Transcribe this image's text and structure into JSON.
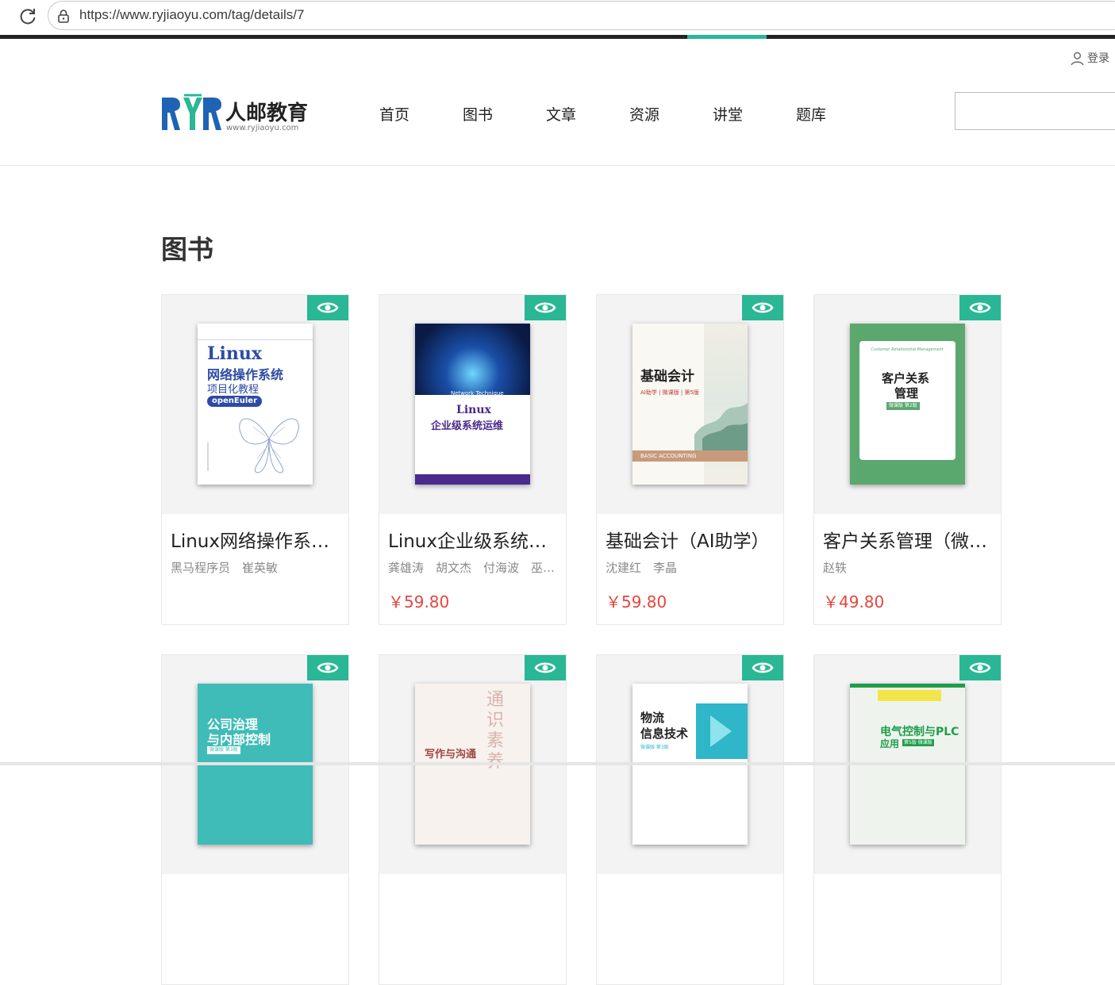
{
  "browser": {
    "url": "https://www.ryjiaoyu.com/tag/details/7"
  },
  "header": {
    "login_label": "登录",
    "logo_text": "人邮教育",
    "logo_url": "www.ryjiaoyu.com",
    "nav": [
      "首页",
      "图书",
      "文章",
      "资源",
      "讲堂",
      "题库"
    ],
    "search_value": ""
  },
  "section": {
    "title": "图书"
  },
  "books": [
    {
      "title": "Linux网络操作系统项目化教程",
      "authors": "黑马程序员　崔英敏",
      "price": "",
      "cover": {
        "line1": "Linux",
        "line2": "网络操作系统",
        "line3": "项目化教程",
        "tag": "openEuler"
      }
    },
    {
      "title": "Linux企业级系统运维",
      "authors": "龚雄涛　胡文杰　付海波　巫健强",
      "price": "￥59.80",
      "cover": {
        "line1": "Linux",
        "line2": "企业级系统运维",
        "tag": "Network Technique"
      }
    },
    {
      "title": "基础会计（AI助学）",
      "authors": "沈建红　李晶",
      "price": "￥59.80",
      "cover": {
        "line1": "基础会计",
        "line2": "AI助学 | 微课版 | 第5版",
        "tag": "BASIC ACCOUNTING"
      }
    },
    {
      "title": "客户关系管理（微课版）",
      "authors": "赵轶",
      "price": "￥49.80",
      "cover": {
        "line1": "客户关系",
        "line2": "管理",
        "tag": "微课版 第2版",
        "line3": "Customer Relationship Management"
      }
    },
    {
      "title": "",
      "authors": "",
      "price": "",
      "cover": {
        "line1": "公司治理",
        "line2": "与内部控制",
        "tag": "微课版 第3版"
      }
    },
    {
      "title": "",
      "authors": "",
      "price": "",
      "cover": {
        "line1": "写作与沟通",
        "line2": "通识素养"
      }
    },
    {
      "title": "",
      "authors": "",
      "price": "",
      "cover": {
        "line1": "物流",
        "line2": "信息技术",
        "tag": "微课版 第3版"
      }
    },
    {
      "title": "",
      "authors": "",
      "price": "",
      "cover": {
        "line1": "电气控制与PLC",
        "line2": "应用",
        "tag": "第5版 微课版"
      }
    }
  ],
  "colors": {
    "accent": "#2ab795",
    "price": "#e8453c"
  }
}
